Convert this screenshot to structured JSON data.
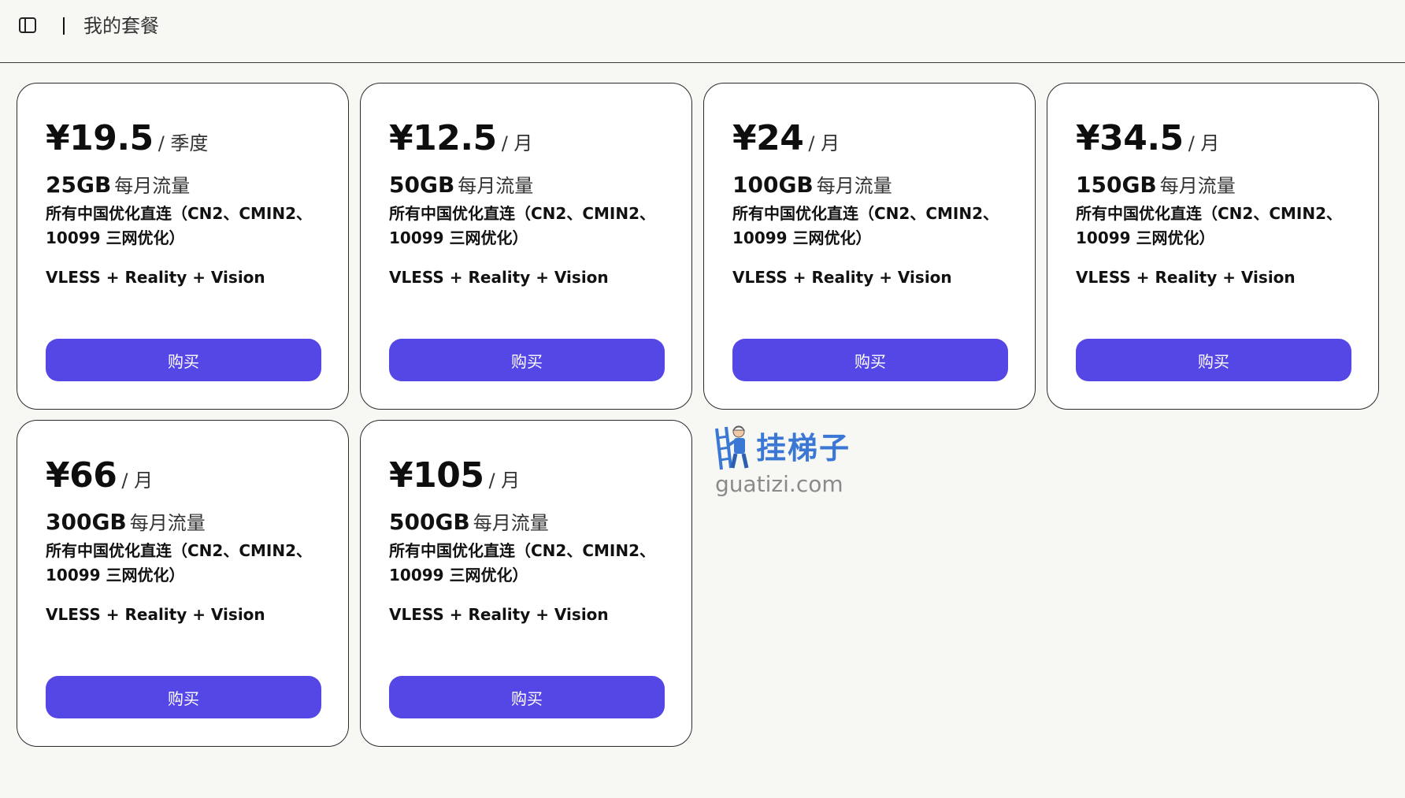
{
  "header": {
    "title": "我的套餐"
  },
  "plans": [
    {
      "price": "¥19.5",
      "period": "/ 季度",
      "traffic": "25GB",
      "traffic_label": "每月流量",
      "feature": "所有中国优化直连（CN2、CMIN2、10099 三网优化）",
      "protocol": "VLESS + Reality + Vision",
      "buy_label": "购买"
    },
    {
      "price": "¥12.5",
      "period": "/ 月",
      "traffic": "50GB",
      "traffic_label": "每月流量",
      "feature": "所有中国优化直连（CN2、CMIN2、10099 三网优化）",
      "protocol": "VLESS + Reality + Vision",
      "buy_label": "购买"
    },
    {
      "price": "¥24",
      "period": "/ 月",
      "traffic": "100GB",
      "traffic_label": "每月流量",
      "feature": "所有中国优化直连（CN2、CMIN2、10099 三网优化）",
      "protocol": "VLESS + Reality + Vision",
      "buy_label": "购买"
    },
    {
      "price": "¥34.5",
      "period": "/ 月",
      "traffic": "150GB",
      "traffic_label": "每月流量",
      "feature": "所有中国优化直连（CN2、CMIN2、10099 三网优化）",
      "protocol": "VLESS + Reality + Vision",
      "buy_label": "购买"
    },
    {
      "price": "¥66",
      "period": "/ 月",
      "traffic": "300GB",
      "traffic_label": "每月流量",
      "feature": "所有中国优化直连（CN2、CMIN2、10099 三网优化）",
      "protocol": "VLESS + Reality + Vision",
      "buy_label": "购买"
    },
    {
      "price": "¥105",
      "period": "/ 月",
      "traffic": "500GB",
      "traffic_label": "每月流量",
      "feature": "所有中国优化直连（CN2、CMIN2、10099 三网优化）",
      "protocol": "VLESS + Reality + Vision",
      "buy_label": "购买"
    }
  ],
  "watermark": {
    "cn": "挂梯子",
    "en": "guatizi.com"
  },
  "colors": {
    "accent": "#5546e6",
    "background": "#f7f7f4",
    "card": "#ffffff",
    "watermark_blue": "#3b78d6"
  },
  "icons": {
    "sidebar_toggle": "sidebar-toggle-icon"
  }
}
